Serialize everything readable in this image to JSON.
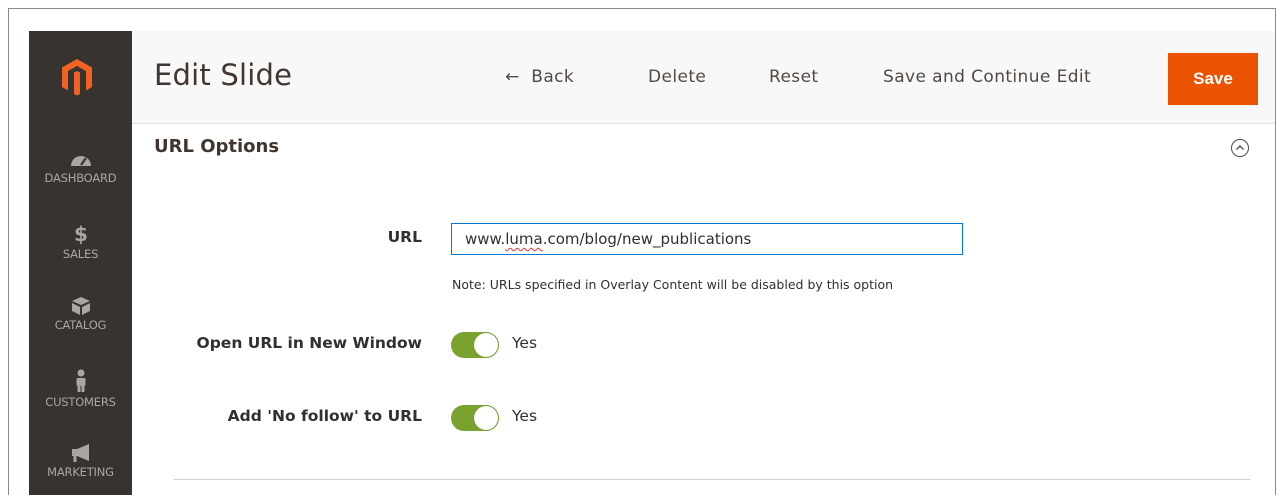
{
  "sidebar": {
    "items": [
      {
        "label": "DASHBOARD",
        "icon": "dashboard-icon"
      },
      {
        "label": "SALES",
        "icon": "dollar-icon"
      },
      {
        "label": "CATALOG",
        "icon": "box-icon"
      },
      {
        "label": "CUSTOMERS",
        "icon": "person-icon"
      },
      {
        "label": "MARKETING",
        "icon": "megaphone-icon"
      }
    ]
  },
  "header": {
    "title": "Edit Slide",
    "back_arrow": "←",
    "back_label": "Back",
    "delete_label": "Delete",
    "reset_label": "Reset",
    "save_continue_label": "Save and Continue Edit",
    "save_label": "Save"
  },
  "section": {
    "title": "URL Options",
    "url_label": "URL",
    "url_value_prefix": "www.",
    "url_value_squiggle": "luma",
    "url_value_suffix": ".com/blog/new_publications",
    "url_note": "Note: URLs specified in Overlay Content will be disabled by this option",
    "new_window_label": "Open URL in New Window",
    "new_window_value": "Yes",
    "nofollow_label": "Add 'No follow' to URL",
    "nofollow_value": "Yes"
  },
  "colors": {
    "sidebar": "#373330",
    "accent": "#eb5202",
    "toggle_on": "#79a22e",
    "focus": "#007bdb"
  }
}
